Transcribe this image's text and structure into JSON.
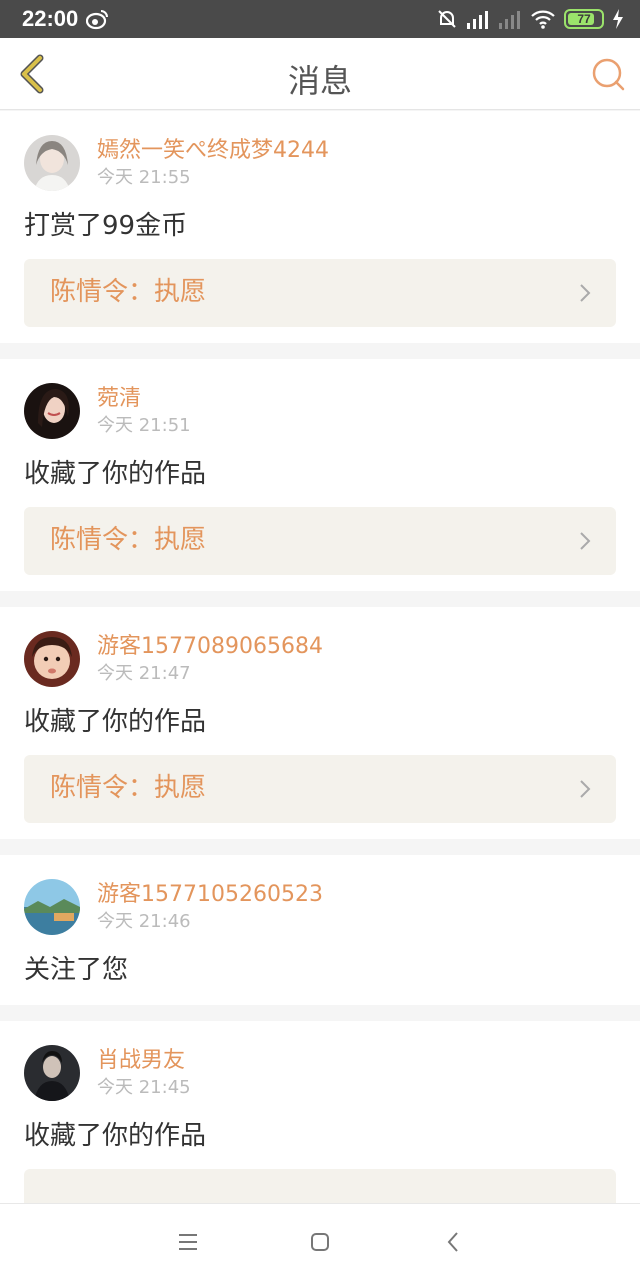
{
  "status_bar": {
    "time": "22:00",
    "battery": "77"
  },
  "nav": {
    "title": "消息"
  },
  "messages": [
    {
      "user": "嫣然一笑ぺ终成梦4244",
      "time": "今天 21:55",
      "action": "打赏了99金币",
      "work": "陈情令：执愿"
    },
    {
      "user": "菀清",
      "time": "今天 21:51",
      "action": "收藏了你的作品",
      "work": "陈情令：执愿"
    },
    {
      "user": "游客1577089065684",
      "time": "今天 21:47",
      "action": "收藏了你的作品",
      "work": "陈情令：执愿"
    },
    {
      "user": "游客1577105260523",
      "time": "今天 21:46",
      "action": "关注了您"
    },
    {
      "user": "肖战男友",
      "time": "今天 21:45",
      "action": "收藏了你的作品"
    }
  ],
  "colors": {
    "accent": "#e3955c",
    "status_bar": "#4a4a4a",
    "work_bg": "#f4f2ec",
    "back_icon": "#d9c04a"
  },
  "icons": [
    "weibo-icon",
    "mute-bell-icon",
    "signal-icon",
    "wifi-icon",
    "battery-icon",
    "charging-icon",
    "back-arrow-icon",
    "search-icon",
    "chevron-right-icon",
    "menu-icon",
    "home-icon",
    "back-icon"
  ]
}
